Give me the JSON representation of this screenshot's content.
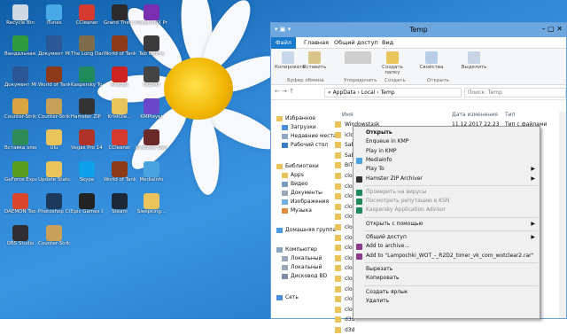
{
  "colors": {
    "desktop_bg": "#2f86d6",
    "ribbon_file_tab": "#1979ca",
    "titlebar": "#6ea7de",
    "menu_bg": "#f0f0f0",
    "folder": "#e8c45a"
  },
  "desktop_icons": [
    {
      "label": "Recycle Bin",
      "icon": "recycle-bin-icon",
      "color": "#cfd8e3"
    },
    {
      "label": "iTunes",
      "icon": "itunes-icon",
      "color": "#49a8e6"
    },
    {
      "label": "CCleaner",
      "icon": "ccleaner-icon",
      "color": "#d43a2f"
    },
    {
      "label": "Grand Theft Auto V",
      "icon": "gta-icon",
      "color": "#2b2b2b"
    },
    {
      "label": "MorphVOX Pro",
      "icon": "morphvox-icon",
      "color": "#7a2fb0"
    },
    {
      "label": "Вандальная...",
      "icon": "app-icon",
      "color": "#2f9b3f"
    },
    {
      "label": "Документ Microsoft",
      "icon": "word-icon",
      "color": "#2b5797"
    },
    {
      "label": "The Long Dark",
      "icon": "game-icon",
      "color": "#7d6d4a"
    },
    {
      "label": "World of Tanks",
      "icon": "wot-icon",
      "color": "#8c3a1a"
    },
    {
      "label": "Tab Online",
      "icon": "app-icon",
      "color": "#3b3b3b"
    },
    {
      "label": "Документ Microsoft...",
      "icon": "word-icon",
      "color": "#2b5797"
    },
    {
      "label": "World of Tanks",
      "icon": "wot-icon",
      "color": "#8c3a1a"
    },
    {
      "label": "Kaspersky Total Se...",
      "icon": "kaspersky-icon",
      "color": "#1f8a5b"
    },
    {
      "label": "Reader",
      "icon": "reader-icon",
      "color": "#c22"
    },
    {
      "label": "GIZMO",
      "icon": "app-icon",
      "color": "#444"
    },
    {
      "label": "Counter-Strike Global Offens...",
      "icon": "csgo-icon",
      "color": "#d9a441"
    },
    {
      "label": "Counter-Strike 1.6",
      "icon": "cs-icon",
      "color": "#c9a05a"
    },
    {
      "label": "Hamster ZIP Archiver",
      "icon": "hamster-zip-icon",
      "color": "#333"
    },
    {
      "label": "KristOle...",
      "icon": "folder-icon",
      "color": "#e8c45a"
    },
    {
      "label": "KMPlayer",
      "icon": "kmplayer-icon",
      "color": "#6b47c9"
    },
    {
      "label": "Вставка элементов",
      "icon": "app-icon",
      "color": "#2e8b57"
    },
    {
      "label": "Ulu",
      "icon": "folder-icon",
      "color": "#e8c45a"
    },
    {
      "label": "Vegas Pro 14.0 (64-bit)",
      "icon": "vegas-icon",
      "color": "#b0332b"
    },
    {
      "label": "CCleaner",
      "icon": "ccleaner-icon",
      "color": "#d43a2f"
    },
    {
      "label": "Kristofer Gemp",
      "icon": "app-icon",
      "color": "#6a2a2a"
    },
    {
      "label": "GeForce Experience",
      "icon": "geforce-icon",
      "color": "#5a9e1f"
    },
    {
      "label": "Update Stats",
      "icon": "folder-icon",
      "color": "#e8c45a"
    },
    {
      "label": "Skype",
      "icon": "skype-icon",
      "color": "#0ea0e8"
    },
    {
      "label": "World of Tanks",
      "icon": "wot-icon",
      "color": "#8c3a1a"
    },
    {
      "label": "MediaInfo",
      "icon": "mediainfo-icon",
      "color": "#4aa3df"
    },
    {
      "label": "DAEMON Tools Lite",
      "icon": "daemon-icon",
      "color": "#d8462e"
    },
    {
      "label": "Photoshop CC 2014",
      "icon": "photoshop-icon",
      "color": "#1c3a5c"
    },
    {
      "label": "Epic Games Launcher",
      "icon": "epic-icon",
      "color": "#222"
    },
    {
      "label": "Steam",
      "icon": "steam-icon",
      "color": "#1b2838"
    },
    {
      "label": "Sleepking...",
      "icon": "folder-icon",
      "color": "#e8c45a"
    },
    {
      "label": "OBS Studio",
      "icon": "obs-icon",
      "color": "#302e31"
    },
    {
      "label": "Counter-Strike...",
      "icon": "cs-icon",
      "color": "#c9a05a"
    }
  ],
  "explorer": {
    "title": "Temp",
    "qat": "▾ ▣ ▾",
    "controls": "–  ▢  ✕",
    "tabs": [
      "Файл",
      "Главная",
      "Общий доступ",
      "Вид"
    ],
    "ribbon": {
      "copy": "Копировать",
      "paste": "Вставить",
      "clipboard_group": "Буфер обмена",
      "organize_group": "Упорядочить",
      "new_folder": "Создать папку",
      "create_group": "Создать",
      "properties": "Свойства",
      "open_group": "Открыть",
      "select": "Выделить"
    },
    "address": "« AppData › Local › Temp",
    "search_placeholder": "Поиск: Temp",
    "columns": {
      "name": "Имя",
      "date": "Дата изменения",
      "type": "Тип"
    },
    "nav": [
      "Избранное",
      "Загрузки",
      "Недавние места",
      "Рабочий стол",
      "Библиотеки",
      "Apps",
      "Видео",
      "Документы",
      "Изображения",
      "Музыка",
      "Домашняя группа",
      "Компьютер",
      "Локальный",
      "Локальный",
      "Дисковод BD",
      "Сеть"
    ],
    "rows": [
      {
        "name": "Windowstask",
        "date": "11.12.2017 22:23",
        "type": "Тип с файлами"
      },
      {
        "name": "iclo",
        "date": "",
        "type": ""
      },
      {
        "name": "Sab",
        "date": "",
        "type": ""
      },
      {
        "name": "Sab",
        "date": "",
        "type": ""
      },
      {
        "name": "BIT",
        "date": "",
        "type": ""
      },
      {
        "name": "clo",
        "date": "",
        "type": ""
      },
      {
        "name": "clo",
        "date": "",
        "type": ""
      },
      {
        "name": "clo",
        "date": "",
        "type": ""
      },
      {
        "name": "clo",
        "date": "",
        "type": ""
      },
      {
        "name": "clo",
        "date": "",
        "type": ""
      },
      {
        "name": "clo",
        "date": "",
        "type": ""
      },
      {
        "name": "clo",
        "date": "",
        "type": ""
      },
      {
        "name": "clo",
        "date": "",
        "type": ""
      },
      {
        "name": "clo",
        "date": "",
        "type": ""
      },
      {
        "name": "clo",
        "date": "",
        "type": ""
      },
      {
        "name": "clo",
        "date": "",
        "type": ""
      },
      {
        "name": "clo",
        "date": "",
        "type": ""
      },
      {
        "name": "clo",
        "date": "",
        "type": ""
      },
      {
        "name": "clo",
        "date": "",
        "type": ""
      },
      {
        "name": "d3d",
        "date": "",
        "type": ""
      },
      {
        "name": "d3d",
        "date": "",
        "type": ""
      }
    ]
  },
  "context_menu": {
    "items": [
      {
        "label": "Открыть",
        "bold": true,
        "disabled": false,
        "submenu": false,
        "icon": ""
      },
      {
        "label": "Enqueue in KMP",
        "bold": false,
        "disabled": false,
        "submenu": false,
        "icon": ""
      },
      {
        "label": "Play in KMP",
        "bold": false,
        "disabled": false,
        "submenu": false,
        "icon": ""
      },
      {
        "label": "MediaInfo",
        "bold": false,
        "disabled": false,
        "submenu": false,
        "icon": "mediainfo-icon"
      },
      {
        "label": "Play To",
        "bold": false,
        "disabled": false,
        "submenu": true,
        "icon": ""
      },
      {
        "label": "Hamster ZIP Archiver",
        "bold": false,
        "disabled": false,
        "submenu": true,
        "icon": "hamster-zip-icon"
      },
      {
        "sep": true
      },
      {
        "label": "Проверить на вирусы",
        "bold": false,
        "disabled": true,
        "submenu": false,
        "icon": "kaspersky-icon"
      },
      {
        "label": "Посмотреть репутацию в KSN",
        "bold": false,
        "disabled": true,
        "submenu": false,
        "icon": "kaspersky-icon"
      },
      {
        "label": "Kaspersky Application Advisor",
        "bold": false,
        "disabled": true,
        "submenu": false,
        "icon": "kaspersky-icon"
      },
      {
        "sep": true
      },
      {
        "label": "Открыть с помощью",
        "bold": false,
        "disabled": false,
        "submenu": true,
        "icon": ""
      },
      {
        "sep": true
      },
      {
        "label": "Общий доступ",
        "bold": false,
        "disabled": false,
        "submenu": true,
        "icon": ""
      },
      {
        "label": "Add to archive...",
        "bold": false,
        "disabled": false,
        "submenu": false,
        "icon": "winrar-icon"
      },
      {
        "label": "Add to \"Lampochki_WOT_-_R2D2_timer_vk_com_wotclear2.rar\"",
        "bold": false,
        "disabled": false,
        "submenu": false,
        "icon": "winrar-icon"
      },
      {
        "sep": true
      },
      {
        "label": "Вырезать",
        "bold": false,
        "disabled": false,
        "submenu": false,
        "icon": ""
      },
      {
        "label": "Копировать",
        "bold": false,
        "disabled": false,
        "submenu": false,
        "icon": ""
      },
      {
        "sep": true
      },
      {
        "label": "Создать ярлык",
        "bold": false,
        "disabled": false,
        "submenu": false,
        "icon": ""
      },
      {
        "label": "Удалить",
        "bold": false,
        "disabled": false,
        "submenu": false,
        "icon": ""
      }
    ]
  }
}
